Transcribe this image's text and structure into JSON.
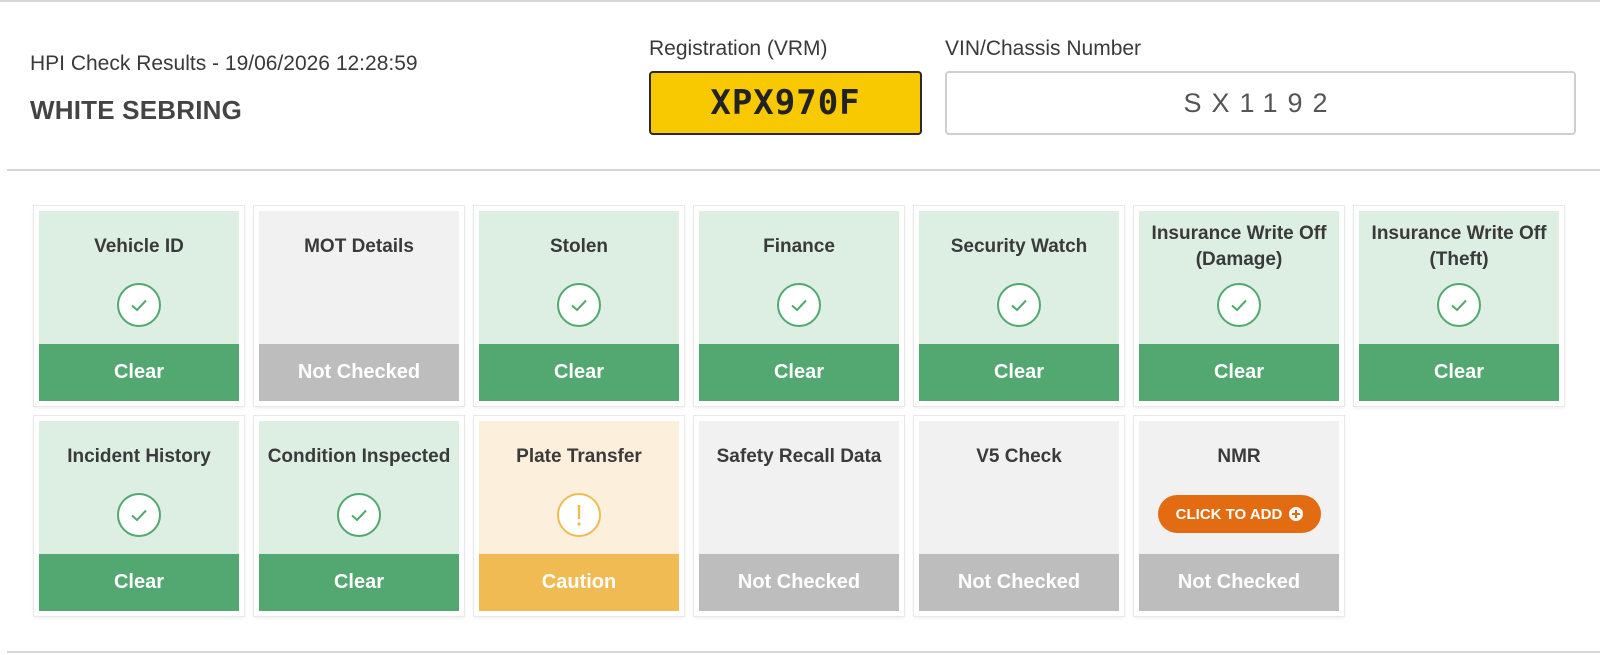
{
  "header": {
    "results_line": "HPI Check Results - 19/06/2026 12:28:59",
    "vehicle_name": "WHITE SEBRING"
  },
  "registration": {
    "label": "Registration (VRM)",
    "value": "XPX970F",
    "plate_color": "#f8c800"
  },
  "vin": {
    "label": "VIN/Chassis Number",
    "value": "SX1192"
  },
  "colors": {
    "clear": "#52a870",
    "clear_bg": "#dcefe2",
    "not_checked": "#bdbdbd",
    "caution": "#efbb52",
    "caution_bg": "#fcefdc",
    "action": "#e36c12"
  },
  "checks": [
    {
      "title": "Vehicle ID",
      "status": "Clear",
      "icon": "check-icon"
    },
    {
      "title": "MOT Details",
      "status": "Not Checked",
      "icon": ""
    },
    {
      "title": "Stolen",
      "status": "Clear",
      "icon": "check-icon"
    },
    {
      "title": "Finance",
      "status": "Clear",
      "icon": "check-icon"
    },
    {
      "title": "Security Watch",
      "status": "Clear",
      "icon": "check-icon"
    },
    {
      "title": "Insurance Write Off (Damage)",
      "status": "Clear",
      "icon": "check-icon"
    },
    {
      "title": "Insurance Write Off (Theft)",
      "status": "Clear",
      "icon": "check-icon"
    },
    {
      "title": "Incident History",
      "status": "Clear",
      "icon": "check-icon"
    },
    {
      "title": "Condition Inspected",
      "status": "Clear",
      "icon": "check-icon"
    },
    {
      "title": "Plate Transfer",
      "status": "Caution",
      "icon": "exclamation-icon"
    },
    {
      "title": "Safety Recall Data",
      "status": "Not Checked",
      "icon": ""
    },
    {
      "title": "V5 Check",
      "status": "Not Checked",
      "icon": ""
    },
    {
      "title": "NMR",
      "status": "Not Checked",
      "icon": "",
      "action_label": "CLICK TO ADD",
      "action_icon": "plus-circle-icon"
    }
  ]
}
